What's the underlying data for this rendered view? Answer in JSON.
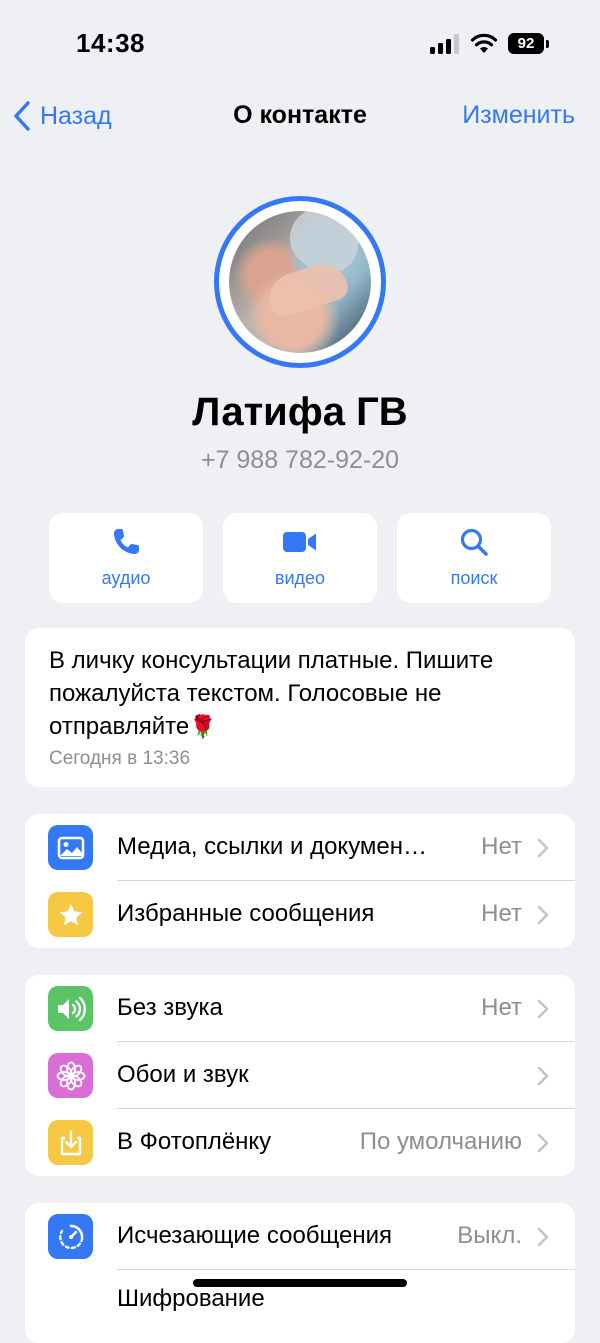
{
  "status_bar": {
    "time": "14:38",
    "battery": "92"
  },
  "nav": {
    "back_label": "Назад",
    "title": "О контакте",
    "edit_label": "Изменить"
  },
  "contact": {
    "name": "Латифа ГВ",
    "phone": "+7 988 782-92-20",
    "avatar_ring_color": "#3478f6"
  },
  "actions": [
    {
      "icon": "phone-icon",
      "label": "аудио"
    },
    {
      "icon": "video-icon",
      "label": "видео"
    },
    {
      "icon": "search-icon",
      "label": "поиск"
    }
  ],
  "about": {
    "text": "В личку консультации платные. Пишите пожалуйста текстом. Голосовые не отправляйте",
    "emoji": "🌹",
    "date": "Сегодня в 13:36"
  },
  "group1": [
    {
      "icon": "media-icon",
      "color": "#3478f6",
      "label": "Медиа, ссылки и докумен…",
      "value": "Нет"
    },
    {
      "icon": "star-icon",
      "color": "#f7c844",
      "label": "Избранные сообщения",
      "value": "Нет"
    }
  ],
  "group2": [
    {
      "icon": "speaker-icon",
      "color": "#5ac466",
      "label": "Без звука",
      "value": "Нет"
    },
    {
      "icon": "flower-icon",
      "color": "#d96fd6",
      "label": "Обои и звук",
      "value": ""
    },
    {
      "icon": "download-icon",
      "color": "#f7c844",
      "label": "В Фотоплёнку",
      "value": "По умолчанию"
    }
  ],
  "group3": [
    {
      "icon": "timer-icon",
      "color": "#3478f6",
      "label": "Исчезающие сообщения",
      "value": "Выкл."
    },
    {
      "label": "Шифрование"
    }
  ],
  "colors": {
    "accent": "#3478f6",
    "background": "#eff0f4",
    "secondary_text": "#8e8e93"
  }
}
